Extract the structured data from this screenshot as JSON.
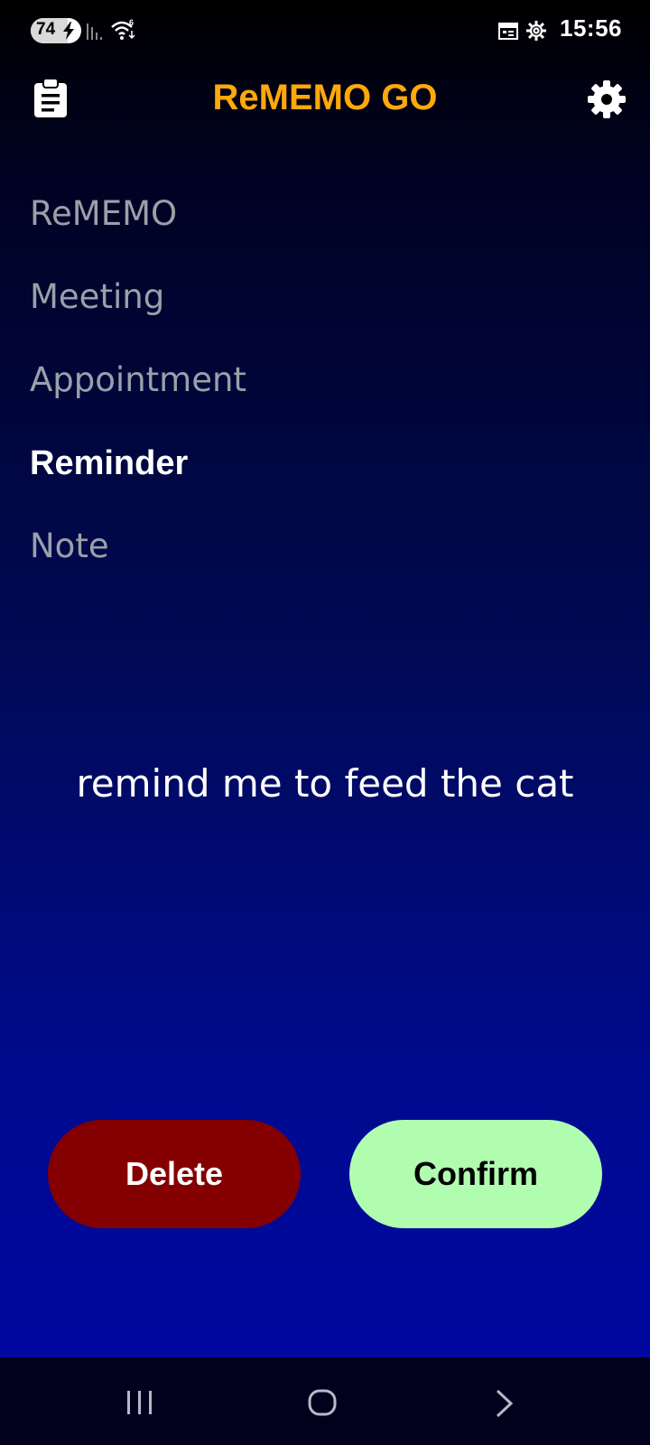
{
  "status_bar": {
    "battery_level": "74",
    "battery_fraction": 0.74,
    "time": "15:56",
    "icons": [
      "battery-charging-icon",
      "signal-icon",
      "wifi-icon",
      "calendar-icon",
      "gear-icon"
    ]
  },
  "app_bar": {
    "title": "ReMEMO GO",
    "left_icon": "clipboard-icon",
    "right_icon": "settings-gear-icon"
  },
  "categories": [
    {
      "label": "ReMEMO",
      "selected": false
    },
    {
      "label": "Meeting",
      "selected": false
    },
    {
      "label": "Appointment",
      "selected": false
    },
    {
      "label": "Reminder",
      "selected": true
    },
    {
      "label": "Note",
      "selected": false
    }
  ],
  "memo": {
    "text": "remind me to feed the cat"
  },
  "actions": {
    "delete_label": "Delete",
    "confirm_label": "Confirm"
  },
  "nav_bar": {
    "icons": [
      "recents-icon",
      "home-icon",
      "back-icon"
    ]
  },
  "colors": {
    "title": "#ffa808",
    "delete_bg": "#840000",
    "confirm_bg": "#b0fdb0",
    "category_inactive": "#9aa0a8",
    "category_active": "#ffffff"
  }
}
